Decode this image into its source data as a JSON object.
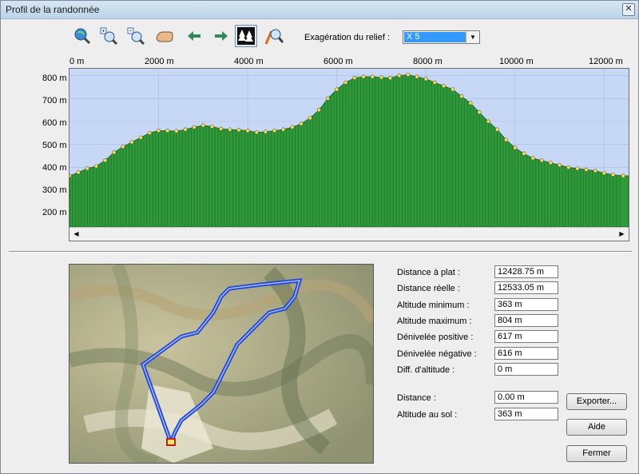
{
  "window": {
    "title": "Profil de la randonnée"
  },
  "toolbar": {
    "icons": [
      "zoom-globe-icon",
      "zoom-in-icon",
      "zoom-out-icon",
      "pan-hand-icon",
      "arrow-left-icon",
      "arrow-right-icon",
      "trees-terrain-icon",
      "profile-search-icon"
    ],
    "exaggeration_label": "Exagération du relief :",
    "exaggeration_value": "X 5"
  },
  "chart_data": {
    "type": "area",
    "xticks": [
      "0 m",
      "2000 m",
      "4000 m",
      "6000 m",
      "8000 m",
      "10000 m",
      "12000 m"
    ],
    "yticks": [
      "800 m",
      "700 m",
      "600 m",
      "500 m",
      "400 m",
      "300 m",
      "200 m"
    ],
    "xlim": [
      0,
      12428
    ],
    "ylim": [
      140,
      830
    ],
    "x": [
      0,
      200,
      400,
      600,
      800,
      1000,
      1200,
      1400,
      1600,
      1800,
      2000,
      2200,
      2400,
      2600,
      2800,
      3000,
      3200,
      3400,
      3600,
      3800,
      4000,
      4200,
      4400,
      4600,
      4800,
      5000,
      5200,
      5400,
      5600,
      5800,
      6000,
      6200,
      6400,
      6600,
      6800,
      7000,
      7200,
      7400,
      7600,
      7800,
      8000,
      8200,
      8400,
      8600,
      8800,
      9000,
      9200,
      9400,
      9600,
      9800,
      10000,
      10200,
      10400,
      10600,
      10800,
      11000,
      11200,
      11400,
      11600,
      11800,
      12000,
      12200,
      12428
    ],
    "y": [
      363,
      378,
      395,
      405,
      430,
      465,
      490,
      510,
      530,
      550,
      560,
      560,
      558,
      565,
      575,
      583,
      578,
      568,
      565,
      563,
      560,
      553,
      555,
      560,
      565,
      575,
      590,
      615,
      650,
      700,
      740,
      770,
      790,
      795,
      795,
      792,
      790,
      800,
      804,
      795,
      785,
      770,
      755,
      740,
      710,
      680,
      640,
      600,
      565,
      520,
      485,
      460,
      440,
      430,
      420,
      410,
      400,
      395,
      390,
      385,
      375,
      368,
      363
    ]
  },
  "stats": {
    "labels": [
      "Distance à plat :",
      "Distance réelle :",
      "Altitude minimum :",
      "Altitude maximum :",
      "Dénivelée positive :",
      "Dénivelée négative :",
      "Diff. d'altitude :"
    ],
    "values": [
      "12428.75 m",
      "12533.05 m",
      "363 m",
      "804 m",
      "617 m",
      "616 m",
      "0 m"
    ],
    "distance_label": "Distance :",
    "distance_value": "0.00 m",
    "ground_alt_label": "Altitude au sol :",
    "ground_alt_value": "363 m"
  },
  "buttons": {
    "export": "Exporter...",
    "help": "Aide",
    "close": "Fermer"
  },
  "colors": {
    "sky": "#c7d8f7",
    "terrain": "#2e9a3a",
    "track": "#1e45e0",
    "marker": "#f4e36a"
  }
}
